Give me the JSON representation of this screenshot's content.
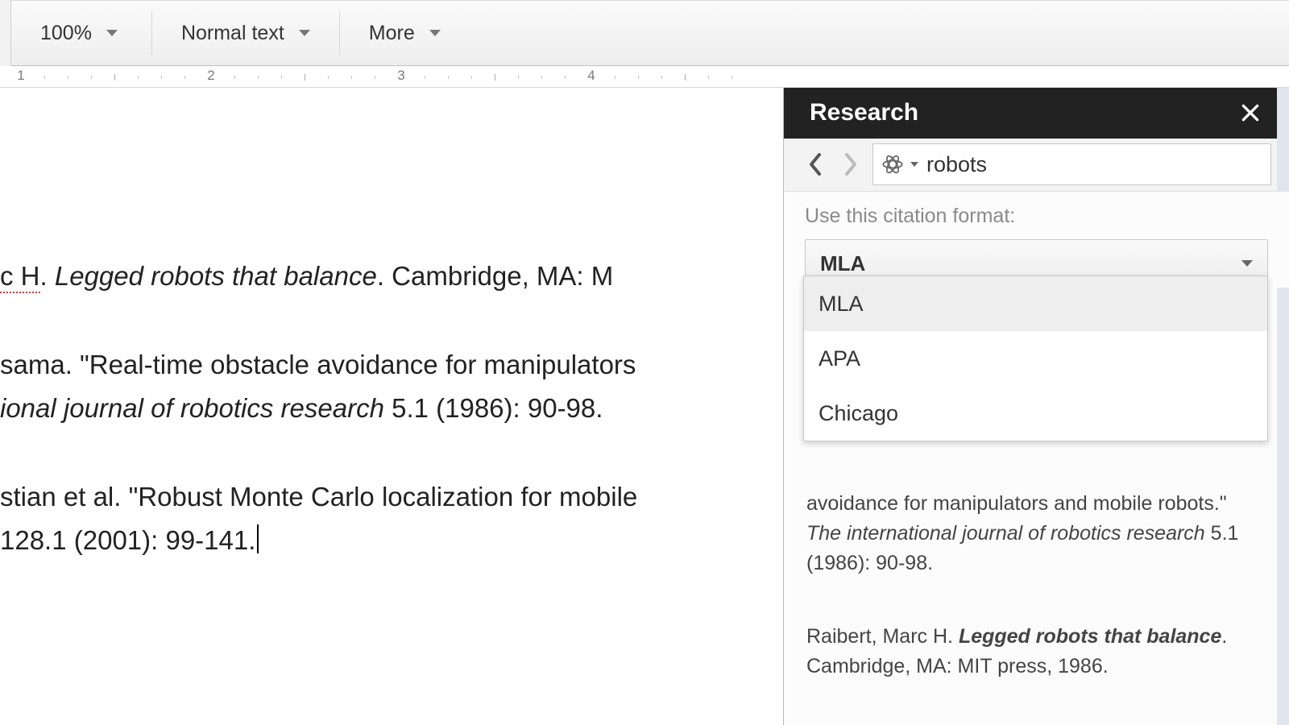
{
  "toolbar": {
    "zoom": "100%",
    "style": "Normal text",
    "more": "More"
  },
  "ruler": {
    "marks": [
      "1",
      "2",
      "3",
      "4"
    ]
  },
  "doc": {
    "lines": [
      {
        "prefix": "c H. ",
        "title": "Legged robots that balance",
        "suffix": ". Cambridge, MA: M",
        "spellerr": "c H"
      },
      {
        "text": "sama. \"Real-time obstacle avoidance for manipulators"
      },
      {
        "prefix": "ional journal of robotics research",
        "ital": true,
        "suffix": " 5.1 (1986): 90-98."
      },
      {
        "text": "stian et al. \"Robust Monte Carlo localization for mobile"
      },
      {
        "text": " 128.1 (2001): 99-141."
      }
    ]
  },
  "research": {
    "title": "Research",
    "search_value": "robots",
    "citation_label": "Use this citation format:",
    "selected_format": "MLA",
    "formats": [
      "MLA",
      "APA",
      "Chicago"
    ],
    "results": [
      {
        "pre": "avoidance for manipulators and mobile robots.\" ",
        "ital": "The international journal of robotics research",
        "post": " 5.1 (1986): 90-98."
      },
      {
        "pre": "Raibert, Marc H. ",
        "boldital": "Legged robots that balance",
        "post": ". Cambridge, MA: MIT press, 1986."
      }
    ]
  }
}
